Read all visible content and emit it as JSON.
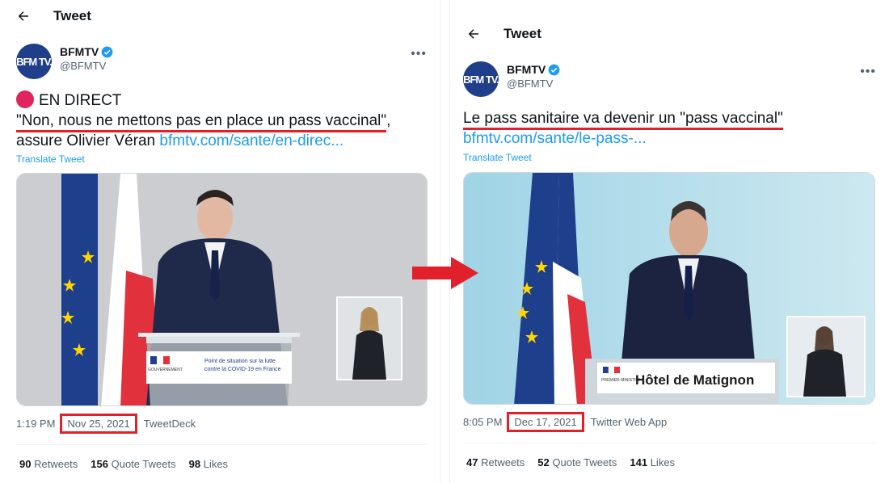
{
  "left": {
    "header_title": "Tweet",
    "avatar_text": "BFM TV.",
    "author_name": "BFMTV",
    "author_handle": "@BFMTV",
    "live_label": "EN DIRECT",
    "quote": "\"Non, nous ne mettons pas en place un pass vaccinal\"",
    "quote_after": ",",
    "text_rest": "assure Olivier Véran ",
    "link": "bfmtv.com/sante/en-direc...",
    "translate": "Translate Tweet",
    "lower_third_line1": "Point de situation sur la lutte",
    "lower_third_line2": "contre la COVID-19 en France",
    "lower_third_gov": "GOUVERNEMENT",
    "time": "1:19 PM",
    "sep": "·",
    "date": "Nov 25, 2021",
    "source": "TweetDeck",
    "retweets_num": "90",
    "retweets_label": "Retweets",
    "quotes_num": "156",
    "quotes_label": "Quote Tweets",
    "likes_num": "98",
    "likes_label": "Likes"
  },
  "right": {
    "header_title": "Tweet",
    "avatar_text": "BFM TV.",
    "author_name": "BFMTV",
    "author_handle": "@BFMTV",
    "text": "Le pass sanitaire va devenir un \"pass vaccinal\"",
    "link": "bfmtv.com/sante/le-pass-...",
    "translate": "Translate Tweet",
    "lower_third_title": "Hôtel de Matignon",
    "lower_third_gov": "PREMIER MINISTRE",
    "time": "8:05 PM",
    "sep": "·",
    "date": "Dec 17, 2021",
    "source": "Twitter Web App",
    "retweets_num": "47",
    "retweets_label": "Retweets",
    "quotes_num": "52",
    "quotes_label": "Quote Tweets",
    "likes_num": "141",
    "likes_label": "Likes"
  },
  "icons": {
    "back": "arrow-left-icon",
    "verified": "verified-badge-icon",
    "more": "more-icon",
    "transition": "red-arrow-icon"
  },
  "colors": {
    "accent": "#1d9bf0",
    "highlight": "#e2202b",
    "live": "#e0245e"
  }
}
